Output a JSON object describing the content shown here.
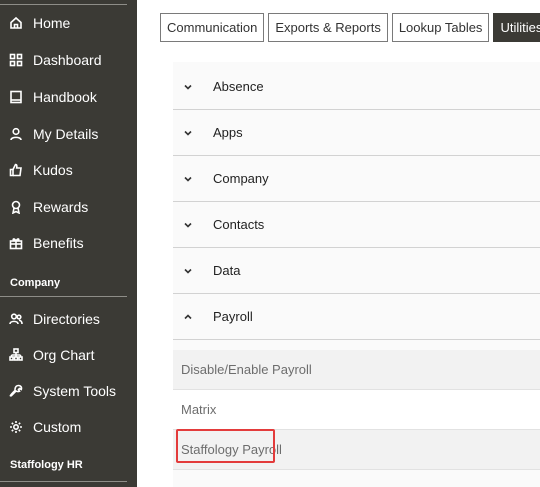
{
  "sidebar": {
    "items": [
      {
        "label": "Home",
        "icon": "home-icon"
      },
      {
        "label": "Dashboard",
        "icon": "grid-icon"
      },
      {
        "label": "Handbook",
        "icon": "book-icon"
      },
      {
        "label": "My Details",
        "icon": "user-icon"
      },
      {
        "label": "Kudos",
        "icon": "thumbs-up-icon"
      },
      {
        "label": "Rewards",
        "icon": "award-icon"
      },
      {
        "label": "Benefits",
        "icon": "gift-icon"
      }
    ],
    "section_company": "Company",
    "company_items": [
      {
        "label": "Directories",
        "icon": "users-icon"
      },
      {
        "label": "Org Chart",
        "icon": "org-chart-icon"
      },
      {
        "label": "System Tools",
        "icon": "wrench-icon"
      },
      {
        "label": "Custom",
        "icon": "gear-icon"
      }
    ],
    "section_staffology": "Staffology HR"
  },
  "tabs": [
    {
      "label": "Communication",
      "active": false
    },
    {
      "label": "Exports & Reports",
      "active": false
    },
    {
      "label": "Lookup Tables",
      "active": false
    },
    {
      "label": "Utilities",
      "active": true
    }
  ],
  "accordion": [
    {
      "label": "Absence",
      "expanded": false
    },
    {
      "label": "Apps",
      "expanded": false
    },
    {
      "label": "Company",
      "expanded": false
    },
    {
      "label": "Contacts",
      "expanded": false
    },
    {
      "label": "Data",
      "expanded": false
    },
    {
      "label": "Payroll",
      "expanded": true
    }
  ],
  "payroll_items": [
    {
      "label": "Disable/Enable Payroll"
    },
    {
      "label": "Matrix"
    },
    {
      "label": "Staffology Payroll",
      "highlighted": true
    }
  ],
  "colors": {
    "sidebar_bg": "#3b3a35",
    "active_tab_bg": "#3b3a35",
    "highlight_border": "#e33b3b"
  }
}
